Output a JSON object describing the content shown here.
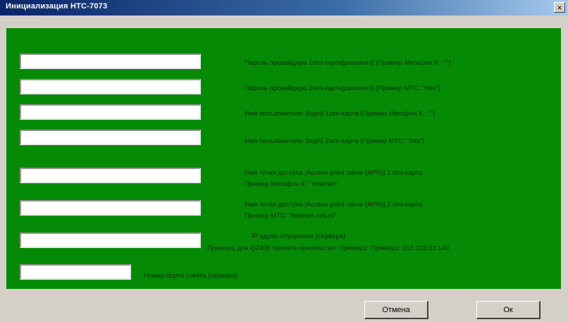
{
  "window": {
    "title": "Инициализация HTC-7073",
    "close_glyph": "×"
  },
  "form": {
    "fields": [
      {
        "value": "",
        "label_lines": [
          "Пароль провайдера 1sim-карта[password] [Пример Мегафон К.: \"\"]"
        ]
      },
      {
        "value": "",
        "label_lines": [
          "Пароль провайдера 2sim-карта[password] [Пример МТС: \"mts\"]"
        ]
      },
      {
        "value": "",
        "label_lines": [
          "Имя пользователя: [login] 1sim-карта [Пример Мегафон К.: \"\"]"
        ]
      },
      {
        "value": "",
        "label_lines": [
          "Имя пользователя: [login] 2sim-карта [Пример МТС: \"mts\"]"
        ]
      },
      {
        "value": "",
        "label_lines": [
          "Имя точки доступа [Access point name (APN)] 1 sim-карта",
          "Пример Мегафон К.: \"internet\""
        ]
      },
      {
        "value": "",
        "label_lines": [
          "Имя точки доступа [Access point name (APN)] 2 sim-карта",
          "Пример МТС: \"internet.mts.ru\""
        ]
      },
      {
        "value": "",
        "label_lines": [
          "IP адрес слушателя (сервера)",
          "Пример1 для Q2406 проекта novotest.net; Пример2: Пример2: 213.132.62.140"
        ]
      },
      {
        "value": "",
        "label_lines": [
          "Номер порта сокета (сервера)"
        ]
      }
    ]
  },
  "buttons": {
    "cancel": "Отмена",
    "ok": "Ок"
  },
  "colors": {
    "panel": "#058a05",
    "titlebar": "#0a246a"
  }
}
